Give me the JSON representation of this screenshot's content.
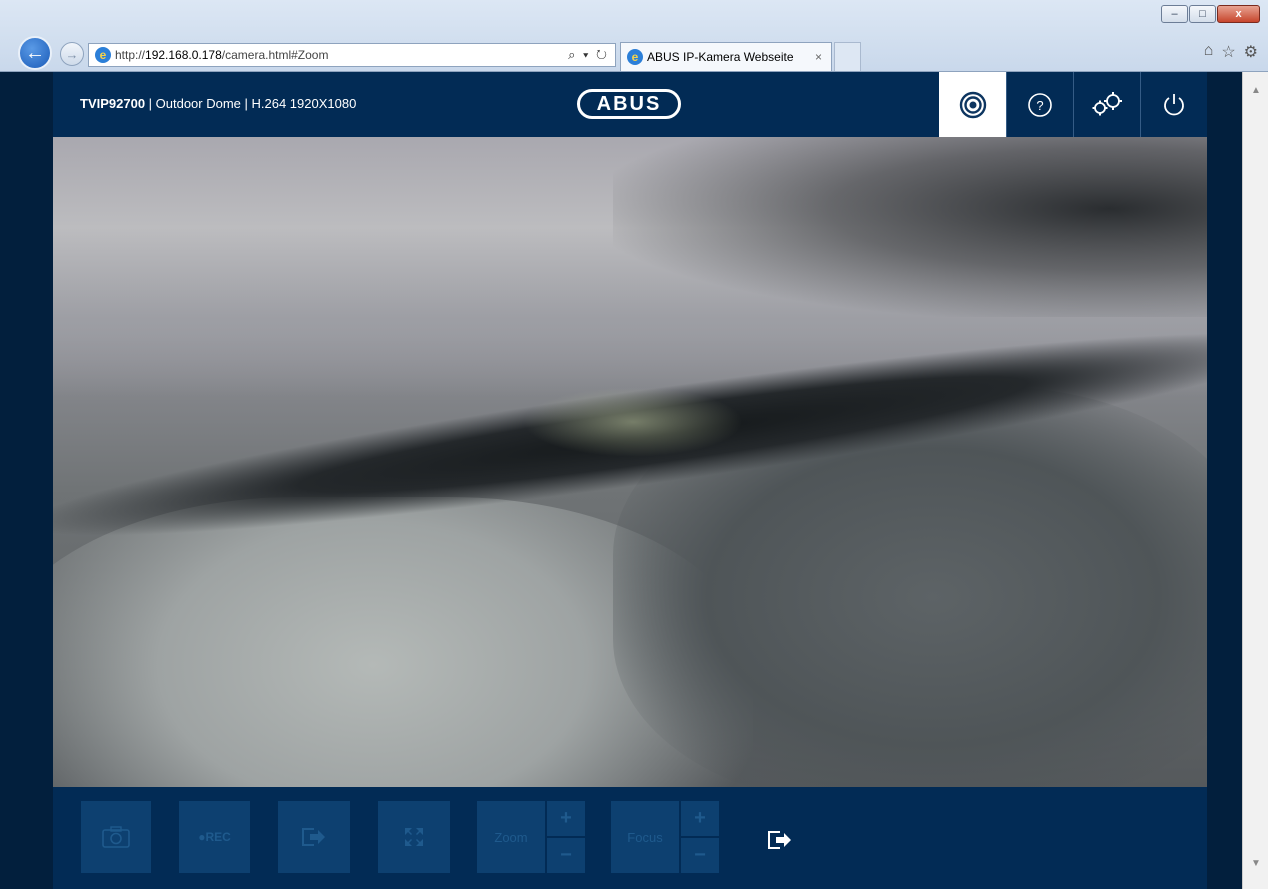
{
  "browser": {
    "url_prefix": "http://",
    "url_host": "192.168.0.178",
    "url_path": "/camera.html#Zoom",
    "search_tools": "⌕ ▾ ↻",
    "tab_title": "ABUS IP-Kamera Webseite",
    "tab_close": "×",
    "window_buttons": {
      "minimize": "–",
      "maximize": "□",
      "close": "x"
    },
    "icons": [
      "home-icon",
      "favorites-star-icon",
      "settings-gear-icon"
    ]
  },
  "header": {
    "model": "TVIP92700",
    "description": " | Outdoor Dome | H.264 1920X1080",
    "logo": "ABUS",
    "nav": [
      {
        "icon": "live-view-icon",
        "active": true
      },
      {
        "icon": "help-icon",
        "active": false
      },
      {
        "icon": "configuration-gears-icon",
        "active": false
      },
      {
        "icon": "power-icon",
        "active": false
      }
    ]
  },
  "toolbar": {
    "rec_label": "●REC",
    "zoom_label": "Zoom",
    "focus_label": "Focus",
    "plus": "+",
    "minus": "−"
  },
  "colors": {
    "page_bg": "#00274d",
    "header_bg": "#022b55",
    "disabled_button": "#0d4070",
    "disabled_text": "#1f5a8d"
  }
}
